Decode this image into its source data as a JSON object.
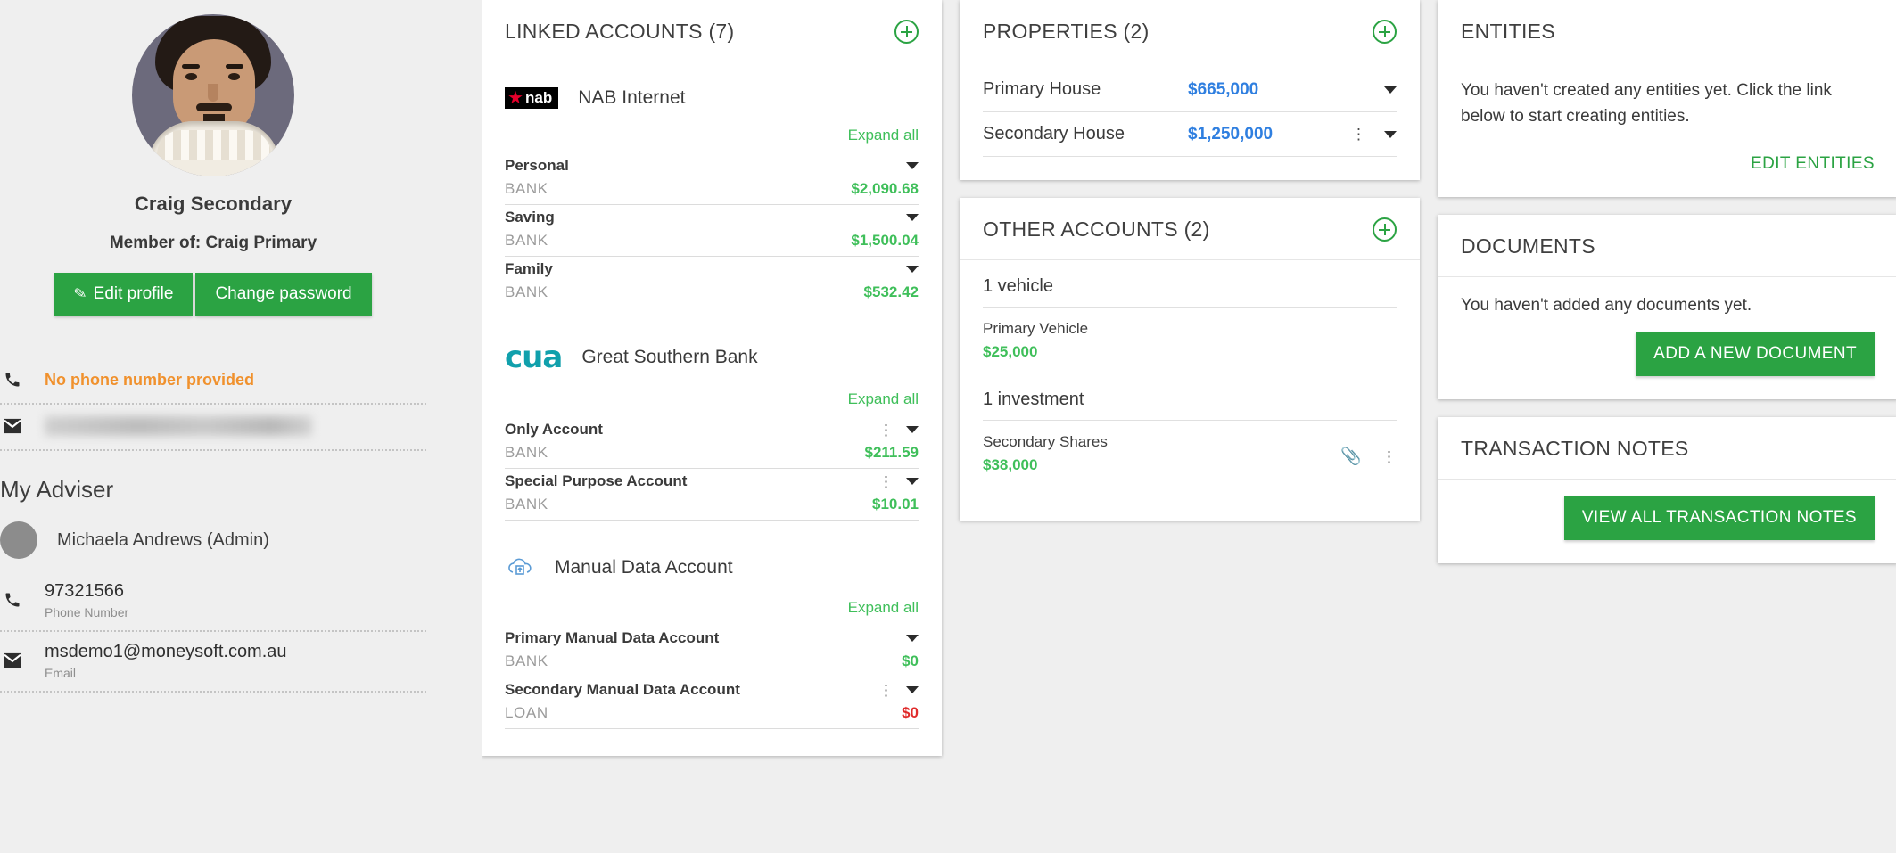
{
  "profile": {
    "name": "Craig Secondary",
    "member_of": "Member of: Craig Primary",
    "edit_profile_label": "Edit profile",
    "change_password_label": "Change password",
    "phone_status": "No phone number provided",
    "email_redacted": ""
  },
  "adviser": {
    "section_title": "My Adviser",
    "name": "Michaela Andrews (Admin)",
    "phone": "97321566",
    "phone_label": "Phone Number",
    "email": "msdemo1@moneysoft.com.au",
    "email_label": "Email"
  },
  "linked_accounts": {
    "title": "LINKED ACCOUNTS (7)",
    "institutions": [
      {
        "name": "NAB Internet",
        "logo": "nab-logo",
        "expand_all_label": "Expand all",
        "accounts": [
          {
            "name": "Personal",
            "type": "BANK",
            "amount": "$2,090.68",
            "negative": false,
            "has_kebab": false
          },
          {
            "name": "Saving",
            "type": "BANK",
            "amount": "$1,500.04",
            "negative": false,
            "has_kebab": false
          },
          {
            "name": "Family",
            "type": "BANK",
            "amount": "$532.42",
            "negative": false,
            "has_kebab": false
          }
        ]
      },
      {
        "name": "Great Southern Bank",
        "logo": "cua-logo",
        "expand_all_label": "Expand all",
        "accounts": [
          {
            "name": "Only Account",
            "type": "BANK",
            "amount": "$211.59",
            "negative": false,
            "has_kebab": true
          },
          {
            "name": "Special Purpose Account",
            "type": "BANK",
            "amount": "$10.01",
            "negative": false,
            "has_kebab": true
          }
        ]
      },
      {
        "name": "Manual Data Account",
        "logo": "cloud-upload-icon",
        "expand_all_label": "Expand all",
        "accounts": [
          {
            "name": "Primary Manual Data Account",
            "type": "BANK",
            "amount": "$0",
            "negative": false,
            "has_kebab": false
          },
          {
            "name": "Secondary Manual Data Account",
            "type": "LOAN",
            "amount": "$0",
            "negative": true,
            "has_kebab": true
          }
        ]
      }
    ]
  },
  "properties": {
    "title": "PROPERTIES (2)",
    "rows": [
      {
        "name": "Primary House",
        "value": "$665,000",
        "has_kebab": false
      },
      {
        "name": "Secondary House",
        "value": "$1,250,000",
        "has_kebab": true
      }
    ]
  },
  "other_accounts": {
    "title": "OTHER ACCOUNTS (2)",
    "groups": [
      {
        "group_title": "1 vehicle",
        "items": [
          {
            "name": "Primary Vehicle",
            "amount": "$25,000",
            "has_clip": false,
            "has_kebab": false
          }
        ]
      },
      {
        "group_title": "1 investment",
        "items": [
          {
            "name": "Secondary Shares",
            "amount": "$38,000",
            "has_clip": true,
            "has_kebab": true
          }
        ]
      }
    ]
  },
  "entities": {
    "title": "ENTITIES",
    "empty_text": "You haven't created any entities yet. Click the link below to start creating entities.",
    "action_label": "EDIT ENTITIES"
  },
  "documents": {
    "title": "DOCUMENTS",
    "empty_text": "You haven't added any documents yet.",
    "action_label": "ADD A NEW DOCUMENT"
  },
  "transaction_notes": {
    "title": "TRANSACTION NOTES",
    "action_label": "VIEW ALL TRANSACTION NOTES"
  },
  "colors": {
    "green": "#2ba343",
    "amount_green": "#3fbf5a",
    "blue": "#2f7fe0",
    "red": "#e02b2b",
    "orange": "#f0912d",
    "cua_teal": "#10a0ac",
    "nab_red": "#e4002b"
  }
}
